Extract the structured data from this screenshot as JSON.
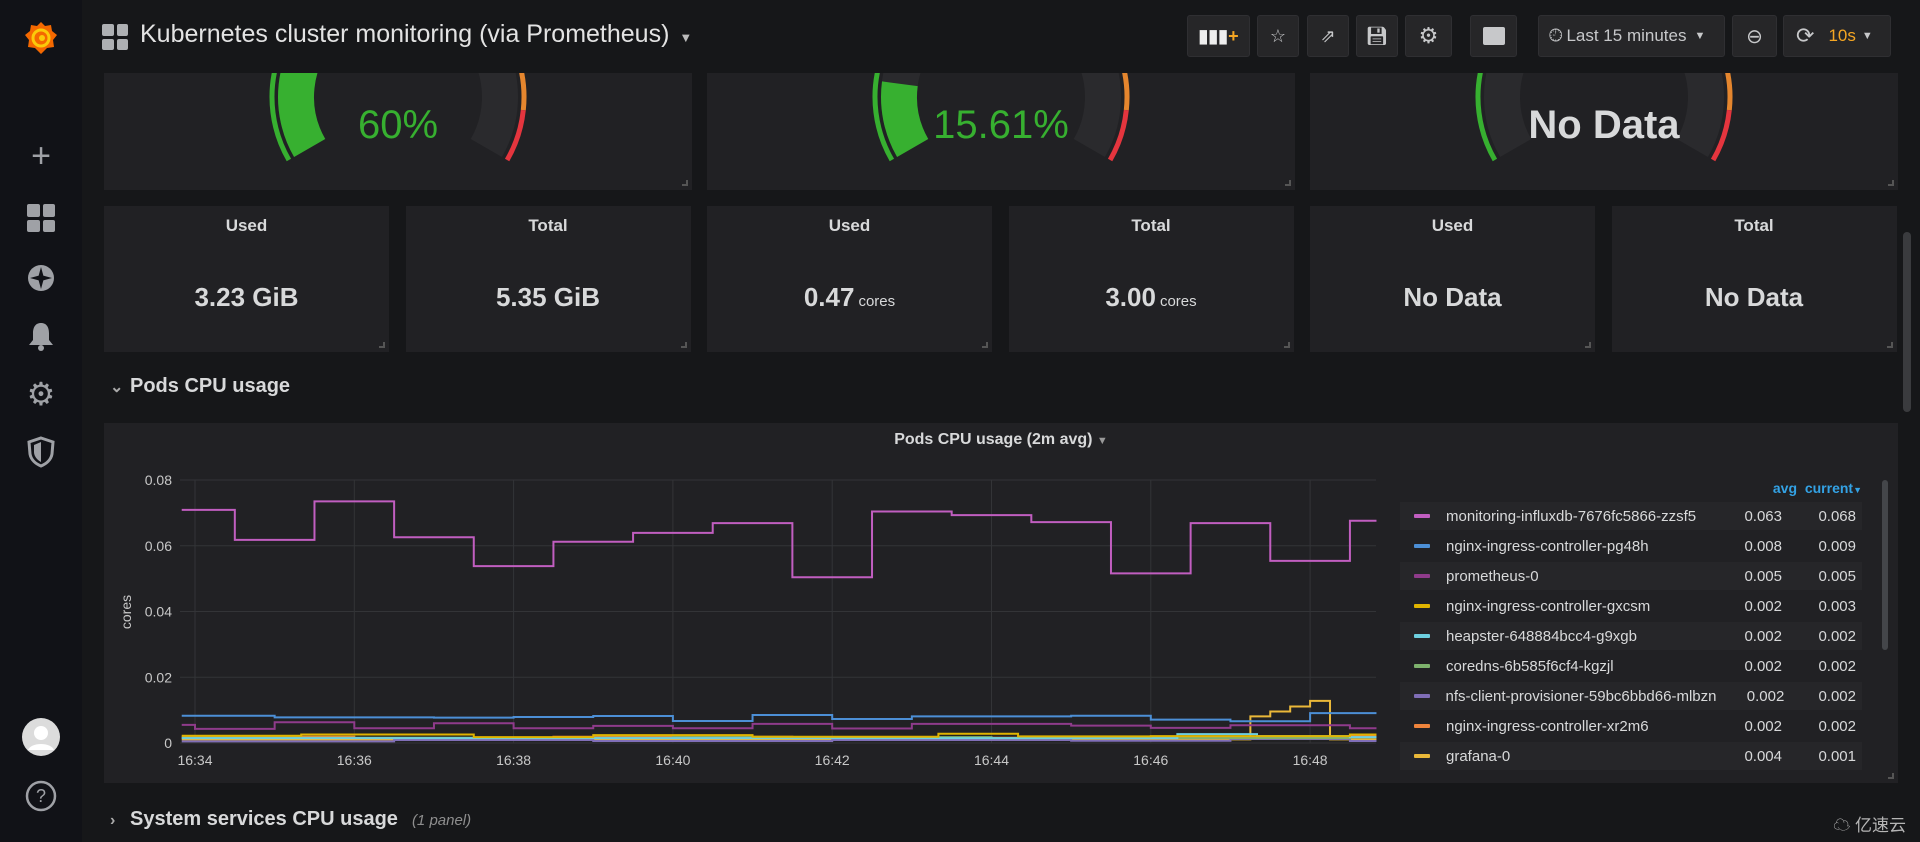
{
  "sidebar": {
    "items": [
      {
        "icon": "grafana-logo-icon"
      },
      {
        "icon": "plus-icon"
      },
      {
        "icon": "dashboards-icon"
      },
      {
        "icon": "explore-compass-icon"
      },
      {
        "icon": "alerting-bell-icon"
      },
      {
        "icon": "configuration-gear-icon"
      },
      {
        "icon": "server-admin-shield-icon"
      },
      {
        "icon": "user-avatar-icon"
      },
      {
        "icon": "help-icon"
      }
    ]
  },
  "header": {
    "title": "Kubernetes cluster monitoring (via Prometheus)",
    "time_range": "Last 15 minutes",
    "refresh": "10s",
    "buttons": [
      "add-panel-icon",
      "star-icon",
      "share-icon",
      "save-icon",
      "settings-gear-icon",
      "tv-mode-monitor-icon"
    ]
  },
  "gauges": [
    {
      "value": "60%",
      "percent": 60,
      "color": "#37b030"
    },
    {
      "value": "15.61%",
      "percent": 15.61,
      "color": "#37b030"
    },
    {
      "value": "No Data",
      "percent": null,
      "color": "#d8d9da"
    }
  ],
  "gauge_thresholds": {
    "colors": [
      "#37b030",
      "#e5862e",
      "#e5353e"
    ],
    "steps": [
      80,
      90
    ]
  },
  "stats": [
    {
      "title": "Used",
      "value": "3.23 GiB",
      "unit": ""
    },
    {
      "title": "Total",
      "value": "5.35 GiB",
      "unit": ""
    },
    {
      "title": "Used",
      "value": "0.47",
      "unit": "cores"
    },
    {
      "title": "Total",
      "value": "3.00",
      "unit": "cores"
    },
    {
      "title": "Used",
      "value": "No Data",
      "unit": ""
    },
    {
      "title": "Total",
      "value": "No Data",
      "unit": ""
    }
  ],
  "rows": [
    {
      "title": "Pods CPU usage"
    },
    {
      "title": "System services CPU usage",
      "count": "(1 panel)"
    }
  ],
  "chart_data": {
    "type": "line",
    "title": "Pods CPU usage (2m avg)",
    "ylabel": "cores",
    "xlabel": "",
    "ylim": [
      0,
      0.08
    ],
    "yticks": [
      "0",
      "0.02",
      "0.04",
      "0.06",
      "0.08"
    ],
    "xticks": [
      "16:34",
      "16:36",
      "16:38",
      "16:40",
      "16:42",
      "16:44",
      "16:46",
      "16:48"
    ],
    "xrange": [
      "16:33:50",
      "16:48:50"
    ],
    "grid": true,
    "stepped": true,
    "legend_placement": "right",
    "legend_columns": [
      "avg",
      "current"
    ],
    "series": [
      {
        "name": "monitoring-influxdb-7676fc5866-zzsf5",
        "color": "#c15ec0",
        "avg": "0.063",
        "current": "0.068",
        "steps": [
          [
            "16:33:50",
            0.0709
          ],
          [
            "16:34:30",
            0.0618
          ],
          [
            "16:35:30",
            0.0735
          ],
          [
            "16:36:30",
            0.0626
          ],
          [
            "16:37:30",
            0.0538
          ],
          [
            "16:38:30",
            0.0612
          ],
          [
            "16:39:30",
            0.0639
          ],
          [
            "16:40:30",
            0.0669
          ],
          [
            "16:41:30",
            0.0504
          ],
          [
            "16:42:30",
            0.0704
          ],
          [
            "16:43:30",
            0.0693
          ],
          [
            "16:44:30",
            0.0672
          ],
          [
            "16:45:30",
            0.0516
          ],
          [
            "16:46:30",
            0.0669
          ],
          [
            "16:47:30",
            0.0554
          ],
          [
            "16:48:30",
            0.0676
          ]
        ]
      },
      {
        "name": "nginx-ingress-controller-pg48h",
        "color": "#4c8fd6",
        "avg": "0.008",
        "current": "0.009",
        "steps": [
          [
            "16:33:50",
            0.0083
          ],
          [
            "16:35:00",
            0.0078
          ],
          [
            "16:37:00",
            0.0077
          ],
          [
            "16:38:00",
            0.0079
          ],
          [
            "16:39:00",
            0.0082
          ],
          [
            "16:40:00",
            0.0067
          ],
          [
            "16:41:00",
            0.0085
          ],
          [
            "16:42:00",
            0.0073
          ],
          [
            "16:43:00",
            0.0081
          ],
          [
            "16:45:00",
            0.0083
          ],
          [
            "16:46:00",
            0.0071
          ],
          [
            "16:47:00",
            0.0066
          ],
          [
            "16:48:00",
            0.0091
          ]
        ]
      },
      {
        "name": "prometheus-0",
        "color": "#8f3b8b",
        "avg": "0.005",
        "current": "0.005",
        "steps": [
          [
            "16:33:50",
            0.0055
          ],
          [
            "16:34:00",
            0.0043
          ],
          [
            "16:35:00",
            0.0063
          ],
          [
            "16:36:00",
            0.0045
          ],
          [
            "16:37:00",
            0.006
          ],
          [
            "16:38:00",
            0.0045
          ],
          [
            "16:39:00",
            0.0052
          ],
          [
            "16:40:00",
            0.0045
          ],
          [
            "16:41:00",
            0.0058
          ],
          [
            "16:42:00",
            0.0044
          ],
          [
            "16:43:00",
            0.0058
          ],
          [
            "16:45:00",
            0.0053
          ],
          [
            "16:46:00",
            0.0046
          ],
          [
            "16:47:00",
            0.0054
          ],
          [
            "16:48:30",
            0.0045
          ]
        ]
      },
      {
        "name": "nginx-ingress-controller-gxcsm",
        "color": "#e0b400",
        "avg": "0.002",
        "current": "0.003",
        "steps": [
          [
            "16:33:50",
            0.0022
          ],
          [
            "16:35:20",
            0.0026
          ],
          [
            "16:37:30",
            0.0018
          ],
          [
            "16:39:00",
            0.0024
          ],
          [
            "16:41:00",
            0.0019
          ],
          [
            "16:43:20",
            0.0028
          ],
          [
            "16:44:20",
            0.002
          ],
          [
            "16:46:00",
            0.0021
          ],
          [
            "16:48:30",
            0.0026
          ]
        ]
      },
      {
        "name": "heapster-648884bcc4-g9xgb",
        "color": "#6ed0e0",
        "avg": "0.002",
        "current": "0.002",
        "steps": [
          [
            "16:33:50",
            0.0015
          ],
          [
            "16:46:20",
            0.0027
          ],
          [
            "16:47:20",
            0.0021
          ],
          [
            "16:48:30",
            0.0018
          ]
        ]
      },
      {
        "name": "coredns-6b585f6cf4-kgzjl",
        "color": "#7eb26d",
        "avg": "0.002",
        "current": "0.002",
        "steps": [
          [
            "16:33:50",
            0.0016
          ],
          [
            "16:40:00",
            0.0018
          ],
          [
            "16:44:00",
            0.0015
          ],
          [
            "16:48:30",
            0.0017
          ]
        ]
      },
      {
        "name": "nfs-client-provisioner-59bc6bbd66-mlbzn",
        "color": "#806eb7",
        "avg": "0.002",
        "current": "0.002",
        "steps": [
          [
            "16:33:50",
            0.0005
          ],
          [
            "16:36:30",
            0.0009
          ],
          [
            "16:39:00",
            0.0006
          ],
          [
            "16:42:00",
            0.0009
          ],
          [
            "16:45:00",
            0.0007
          ],
          [
            "16:47:00",
            0.0012
          ],
          [
            "16:48:30",
            0.0006
          ]
        ]
      },
      {
        "name": "nginx-ingress-controller-xr2m6",
        "color": "#ef843c",
        "avg": "0.002",
        "current": "0.002",
        "steps": [
          [
            "16:33:50",
            0.0019
          ],
          [
            "16:36:00",
            0.0015
          ],
          [
            "16:38:30",
            0.0019
          ],
          [
            "16:41:30",
            0.0016
          ],
          [
            "16:44:30",
            0.0019
          ],
          [
            "16:47:00",
            0.0017
          ],
          [
            "16:48:30",
            0.002
          ]
        ]
      },
      {
        "name": "grafana-0",
        "color": "#eab839",
        "avg": "0.004",
        "current": "0.001",
        "steps": [
          [
            "16:33:50",
            0.0011
          ],
          [
            "16:47:15",
            0.0081
          ],
          [
            "16:47:30",
            0.0096
          ],
          [
            "16:47:45",
            0.0111
          ],
          [
            "16:48:00",
            0.0128
          ],
          [
            "16:48:15",
            0.0011
          ]
        ]
      }
    ]
  },
  "watermark": {
    "text": "亿速云"
  }
}
